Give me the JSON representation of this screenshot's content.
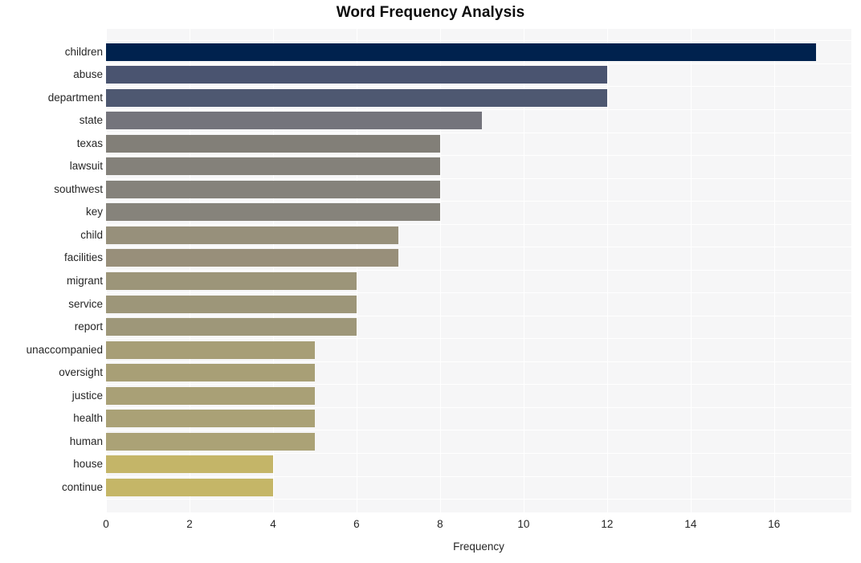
{
  "chart_data": {
    "type": "bar",
    "orientation": "horizontal",
    "title": "Word Frequency Analysis",
    "xlabel": "Frequency",
    "ylabel": "",
    "xlim": [
      0,
      17.85
    ],
    "xticks": [
      0,
      2,
      4,
      6,
      8,
      10,
      12,
      14,
      16
    ],
    "xtick_labels": [
      "0",
      "2",
      "4",
      "6",
      "8",
      "10",
      "12",
      "14",
      "16"
    ],
    "grid": true,
    "grid_color": "#ffffff",
    "plot_background": "#f6f6f7",
    "figure_background": "#ffffff",
    "legend": null,
    "colormap": "cividis",
    "categories": [
      "children",
      "abuse",
      "department",
      "state",
      "texas",
      "lawsuit",
      "southwest",
      "key",
      "child",
      "facilities",
      "migrant",
      "service",
      "report",
      "unaccompanied",
      "oversight",
      "justice",
      "health",
      "human",
      "house",
      "continue"
    ],
    "values": [
      17,
      12,
      12,
      9,
      8,
      8,
      8,
      8,
      7,
      7,
      6,
      6,
      6,
      5,
      5,
      5,
      5,
      5,
      4,
      4
    ],
    "bar_colors": [
      "#00224e",
      "#4a5470",
      "#4e5871",
      "#74747c",
      "#827f78",
      "#84817a",
      "#85827b",
      "#86837b",
      "#97907b",
      "#988f7a",
      "#9c9579",
      "#9d9679",
      "#9e9779",
      "#a79e76",
      "#a89f76",
      "#a9a076",
      "#aaa176",
      "#aba276",
      "#c4b568",
      "#c5b667"
    ]
  },
  "axis": {
    "xlabel_text": "Frequency",
    "title_text": "Word Frequency Analysis"
  }
}
